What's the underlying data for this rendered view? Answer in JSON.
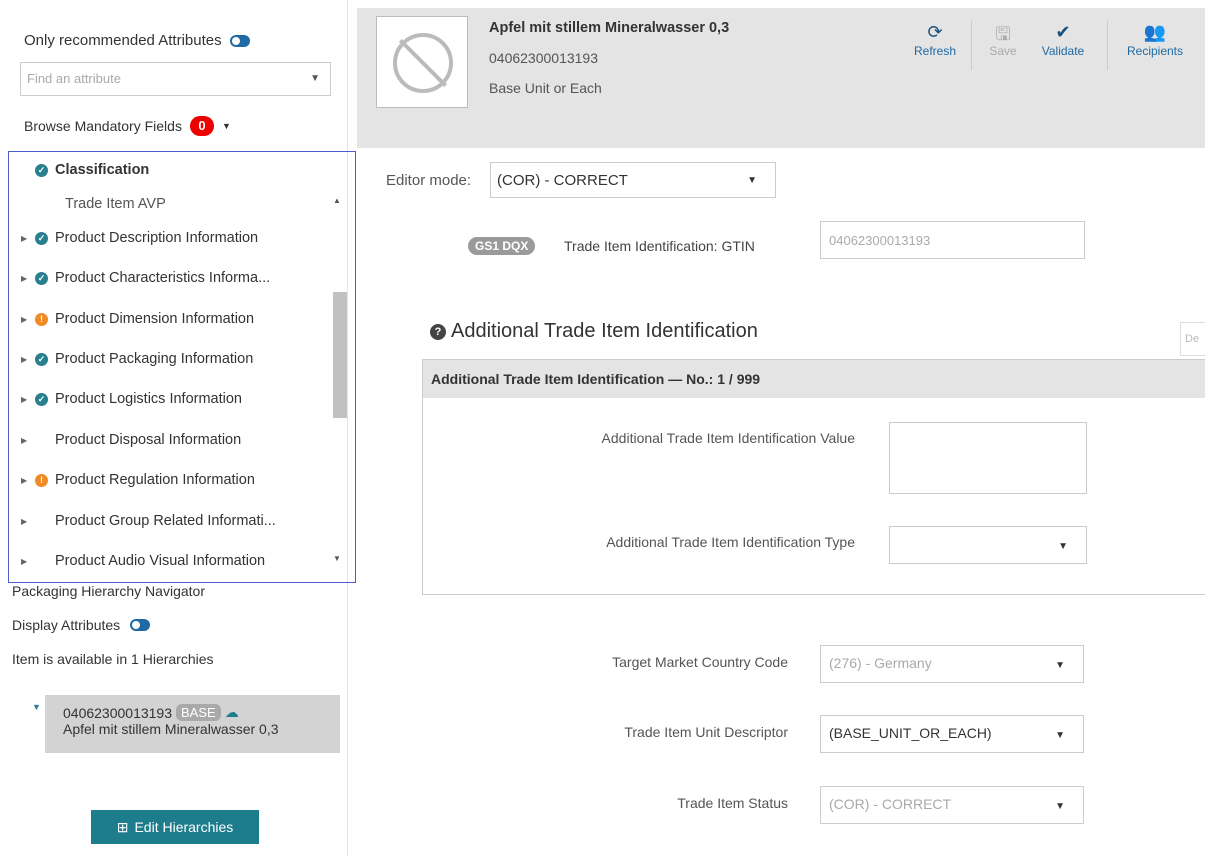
{
  "left": {
    "recommended_label": "Only recommended Attributes",
    "find_placeholder": "Find an attribute",
    "browse_label": "Browse Mandatory Fields",
    "mandatory_count": "0",
    "tree": [
      {
        "label": "Classification",
        "status": "ok",
        "expandable": false
      },
      {
        "label": "Trade Item AVP",
        "status": "none",
        "expandable": false,
        "sub": true
      },
      {
        "label": "Product Description Information",
        "status": "ok",
        "expandable": true
      },
      {
        "label": "Product Characteristics Informa...",
        "status": "ok",
        "expandable": true
      },
      {
        "label": "Product Dimension Information",
        "status": "warn",
        "expandable": true
      },
      {
        "label": "Product Packaging Information",
        "status": "ok",
        "expandable": true
      },
      {
        "label": "Product Logistics Information",
        "status": "ok",
        "expandable": true
      },
      {
        "label": "Product Disposal Information",
        "status": "none",
        "expandable": true
      },
      {
        "label": "Product Regulation Information",
        "status": "warn",
        "expandable": true
      },
      {
        "label": "Product Group Related Informati...",
        "status": "none",
        "expandable": true
      },
      {
        "label": "Product Audio Visual Information",
        "status": "none",
        "expandable": true
      }
    ],
    "packaging_nav": "Packaging Hierarchy Navigator",
    "display_attributes": "Display Attributes",
    "available_text": "Item is available in 1 Hierarchies",
    "hierarchy_gtin": "04062300013193",
    "hierarchy_tag": "BASE",
    "hierarchy_name": "Apfel mit stillem Mineralwasser 0,3",
    "edit_button": "Edit Hierarchies"
  },
  "header": {
    "title": "Apfel mit stillem Mineralwasser 0,3",
    "gtin": "04062300013193",
    "unit": "Base Unit or Each",
    "toolbar": {
      "refresh": "Refresh",
      "save": "Save",
      "validate": "Validate",
      "recipients": "Recipients"
    }
  },
  "main": {
    "editor_mode_label": "Editor mode:",
    "editor_mode_value": "(COR) - CORRECT",
    "gs1_badge": "GS1 DQX",
    "gtin_label": "Trade Item Identification: GTIN",
    "gtin_value": "04062300013193",
    "section_title": "Additional Trade Item Identification",
    "mini_button": "De",
    "group_header": "Additional Trade Item Identification — No.: 1 / 999",
    "fields": {
      "add_value_label": "Additional Trade Item Identification Value",
      "add_value": "",
      "add_type_label": "Additional Trade Item Identification Type",
      "add_type": "",
      "country_label": "Target Market Country Code",
      "country_value": "(276) - Germany",
      "unit_desc_label": "Trade Item Unit Descriptor",
      "unit_desc_value": "(BASE_UNIT_OR_EACH)",
      "status_label": "Trade Item Status",
      "status_value": "(COR) - CORRECT"
    }
  },
  "colors": {
    "accent": "#1e7d8c",
    "ok": "#2a7f8e",
    "warn": "#f08a24",
    "badge": "#e00000"
  }
}
